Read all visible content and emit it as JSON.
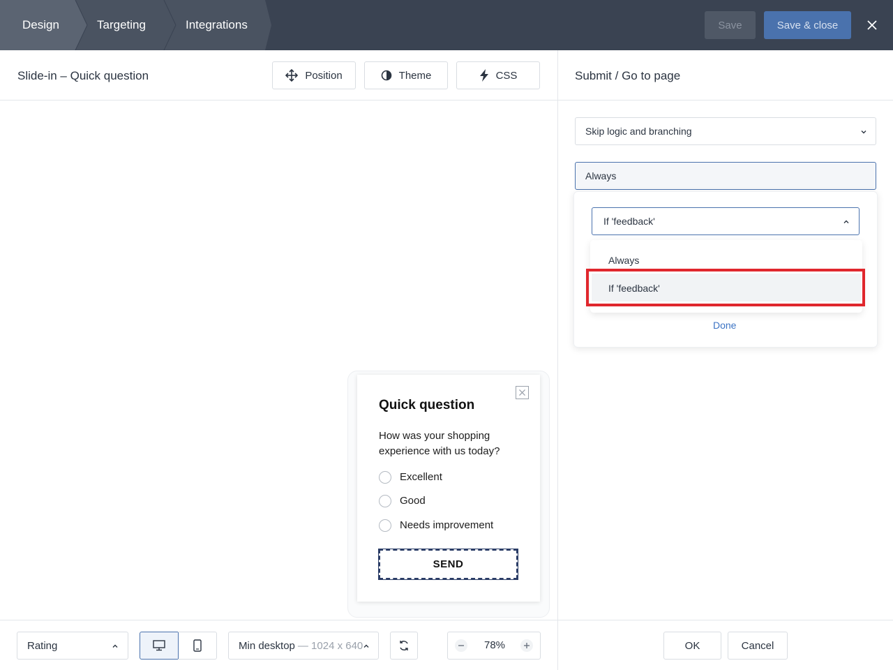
{
  "topbar": {
    "tabs": [
      {
        "label": "Design"
      },
      {
        "label": "Targeting"
      },
      {
        "label": "Integrations"
      }
    ],
    "save_label": "Save",
    "save_close_label": "Save & close"
  },
  "editor": {
    "title": "Slide-in – Quick question",
    "position_label": "Position",
    "theme_label": "Theme",
    "css_label": "CSS"
  },
  "right_panel": {
    "title": "Submit / Go to page",
    "skip_logic_label": "Skip logic and branching",
    "condition_value": "Always",
    "condition_select_value": "If 'feedback'",
    "options": [
      "Always",
      "If 'feedback'"
    ],
    "done_label": "Done"
  },
  "preview": {
    "title": "Quick question",
    "question": "How was your shopping experience with us today?",
    "choices": [
      "Excellent",
      "Good",
      "Needs improvement"
    ],
    "send_label": "SEND"
  },
  "bottombar": {
    "question_type": "Rating",
    "viewport_label": "Min desktop",
    "viewport_size": "— 1024 x 640",
    "zoom": "78%",
    "ok_label": "OK",
    "cancel_label": "Cancel"
  },
  "colors": {
    "topbar": "#3a4352",
    "accent": "#4a72ad",
    "highlight": "#e0272d",
    "link": "#3d74c4"
  }
}
